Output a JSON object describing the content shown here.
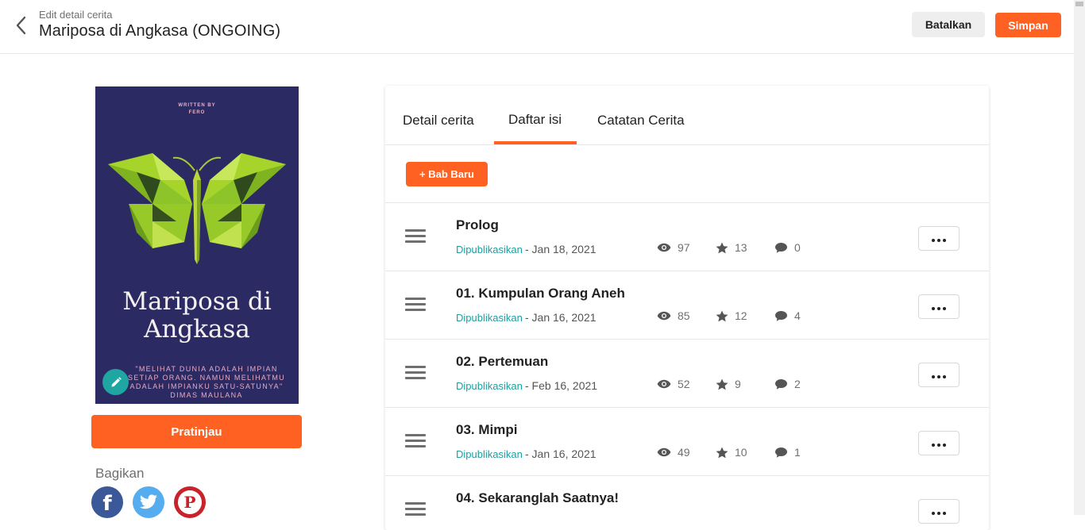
{
  "header": {
    "subtitle": "Edit detail cerita",
    "title": "Mariposa di Angkasa (ONGOING)",
    "cancel_label": "Batalkan",
    "save_label": "Simpan"
  },
  "cover": {
    "written_by": "WRITTEN BY",
    "author": "FERO",
    "title_line1": "Mariposa di",
    "title_line2": "Angkasa",
    "quote": "\"MELIHAT DUNIA ADALAH IMPIAN SETIAP ORANG. NAMUN MELIHATMU ADALAH IMPIANKU SATU-SATUNYA\" DIMAS MAULANA"
  },
  "preview_label": "Pratinjau",
  "share": {
    "label": "Bagikan",
    "facebook_glyph": "f",
    "pinterest_glyph": "P"
  },
  "tabs": [
    {
      "label": "Detail cerita",
      "active": false
    },
    {
      "label": "Daftar isi",
      "active": true
    },
    {
      "label": "Catatan Cerita",
      "active": false
    }
  ],
  "new_chapter_label": "+ Bab Baru",
  "chapters": [
    {
      "title": "Prolog",
      "status": "Dipublikasikan",
      "date": "- Jan 18, 2021",
      "views": "97",
      "votes": "13",
      "comments": "0"
    },
    {
      "title": "01. Kumpulan Orang Aneh",
      "status": "Dipublikasikan",
      "date": "- Jan 16, 2021",
      "views": "85",
      "votes": "12",
      "comments": "4"
    },
    {
      "title": "02. Pertemuan",
      "status": "Dipublikasikan",
      "date": "- Feb 16, 2021",
      "views": "52",
      "votes": "9",
      "comments": "2"
    },
    {
      "title": "03. Mimpi",
      "status": "Dipublikasikan",
      "date": "- Jan 16, 2021",
      "views": "49",
      "votes": "10",
      "comments": "1"
    },
    {
      "title": "04. Sekaranglah Saatnya!",
      "status": "",
      "date": "",
      "views": "",
      "votes": "",
      "comments": ""
    }
  ],
  "colors": {
    "accent": "#ff6122",
    "published": "#1aa0a1",
    "cover_bg": "#2c2a63"
  },
  "icons": [
    "chevron-left-icon",
    "pencil-icon",
    "drag-handle-icon",
    "eye-icon",
    "star-icon",
    "comment-icon",
    "more-icon",
    "facebook-icon",
    "twitter-icon",
    "pinterest-icon"
  ]
}
